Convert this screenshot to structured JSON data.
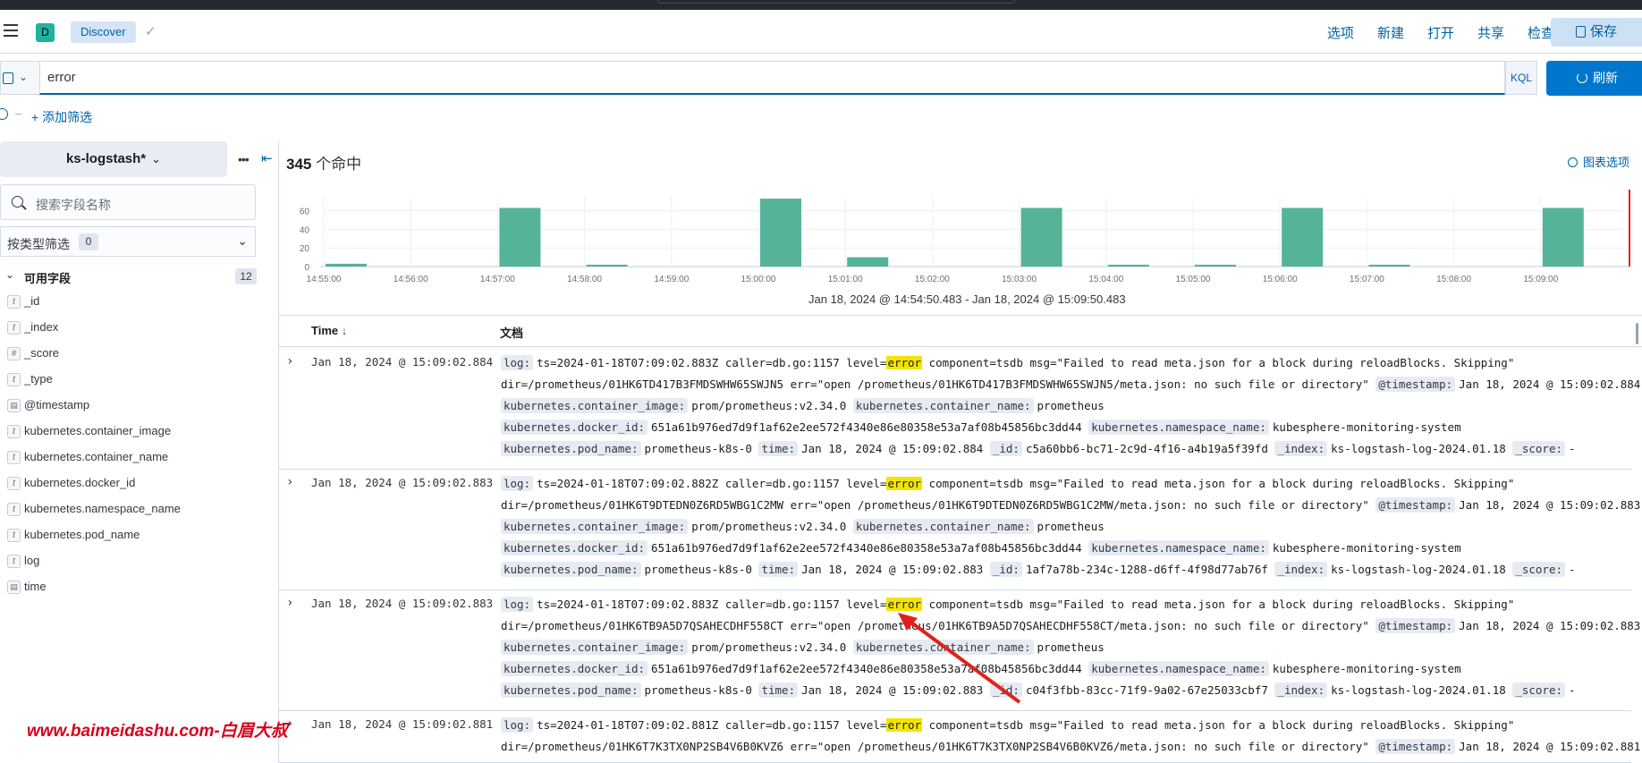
{
  "header": {
    "space_initial": "D",
    "breadcrumb": "Discover",
    "menu": [
      "选项",
      "新建",
      "打开",
      "共享",
      "检查"
    ],
    "save_label": "保存"
  },
  "query": {
    "value": "error",
    "language": "KQL",
    "refresh_label": "刷新"
  },
  "filters": {
    "add_label": "+ 添加筛选"
  },
  "sidebar": {
    "index_pattern": "ks-logstash*",
    "search_placeholder": "搜索字段名称",
    "type_filter_label": "按类型筛选",
    "type_filter_count": "0",
    "available_label": "可用字段",
    "available_count": "12",
    "fields": [
      {
        "type": "t",
        "name": "_id"
      },
      {
        "type": "t",
        "name": "_index"
      },
      {
        "type": "#",
        "name": "_score"
      },
      {
        "type": "t",
        "name": "_type"
      },
      {
        "type": "date",
        "name": "@timestamp"
      },
      {
        "type": "t",
        "name": "kubernetes.container_image"
      },
      {
        "type": "t",
        "name": "kubernetes.container_name"
      },
      {
        "type": "t",
        "name": "kubernetes.docker_id"
      },
      {
        "type": "t",
        "name": "kubernetes.namespace_name"
      },
      {
        "type": "t",
        "name": "kubernetes.pod_name"
      },
      {
        "type": "t",
        "name": "log"
      },
      {
        "type": "date",
        "name": "time"
      }
    ]
  },
  "main": {
    "hits_count": "345",
    "hits_suffix": " 个命中",
    "chart_options_label": "图表选项",
    "time_range": "Jan 18, 2024 @ 14:54:50.483 - Jan 18, 2024 @ 15:09:50.483",
    "col_time": "Time",
    "col_doc": "文档"
  },
  "chart_data": {
    "type": "bar",
    "x_ticks": [
      "14:55:00",
      "14:56:00",
      "14:57:00",
      "14:58:00",
      "14:59:00",
      "15:00:00",
      "15:01:00",
      "15:02:00",
      "15:03:00",
      "15:04:00",
      "15:05:00",
      "15:06:00",
      "15:07:00",
      "15:08:00",
      "15:09:00"
    ],
    "y_ticks": [
      0,
      20,
      40,
      60
    ],
    "ylim": [
      0,
      75
    ],
    "bars": [
      {
        "t": "14:55:00",
        "value": 3
      },
      {
        "t": "14:57:00",
        "value": 63
      },
      {
        "t": "14:58:00",
        "value": 2
      },
      {
        "t": "15:00:00",
        "value": 73
      },
      {
        "t": "15:01:00",
        "value": 10
      },
      {
        "t": "15:03:00",
        "value": 63
      },
      {
        "t": "15:04:00",
        "value": 2
      },
      {
        "t": "15:05:00",
        "value": 2
      },
      {
        "t": "15:06:00",
        "value": 63
      },
      {
        "t": "15:07:00",
        "value": 2
      },
      {
        "t": "15:09:00",
        "value": 63
      }
    ],
    "bar_color": "#54b399"
  },
  "rows": [
    {
      "ts": "Jan 18, 2024 @ 15:09:02.884",
      "log_pre": "ts=2024-01-18T07:09:02.883Z caller=db.go:1157 level=",
      "log_hl": "error",
      "log_post": " component=tsdb msg=\"Failed to read meta.json for a block during reloadBlocks. Skipping\"",
      "log_cont": "dir=/prometheus/01HK6TD417B3FMDSWHW65SWJN5 err=\"open /prometheus/01HK6TD417B3FMDSWHW65SWJN5/meta.json: no such file or directory\"",
      "timestamp": "Jan 18, 2024 @ 15:09:02.884",
      "container_image": "prom/prometheus:v2.34.0",
      "container_name": "prometheus",
      "docker_id": "651a61b976ed7d9f1af62e2ee572f4340e86e80358e53a7af08b45856bc3dd44",
      "namespace_name": "kubesphere-monitoring-system",
      "pod_name": "prometheus-k8s-0",
      "time": "Jan 18, 2024 @ 15:09:02.884",
      "id": "c5a60bb6-bc71-2c9d-4f16-a4b19a5f39fd",
      "index": "ks-logstash-log-2024.01.18",
      "score": "-"
    },
    {
      "ts": "Jan 18, 2024 @ 15:09:02.883",
      "log_pre": "ts=2024-01-18T07:09:02.882Z caller=db.go:1157 level=",
      "log_hl": "error",
      "log_post": " component=tsdb msg=\"Failed to read meta.json for a block during reloadBlocks. Skipping\"",
      "log_cont": "dir=/prometheus/01HK6T9DTEDN0Z6RD5WBG1C2MW err=\"open /prometheus/01HK6T9DTEDN0Z6RD5WBG1C2MW/meta.json: no such file or directory\"",
      "timestamp": "Jan 18, 2024 @ 15:09:02.883",
      "container_image": "prom/prometheus:v2.34.0",
      "container_name": "prometheus",
      "docker_id": "651a61b976ed7d9f1af62e2ee572f4340e86e80358e53a7af08b45856bc3dd44",
      "namespace_name": "kubesphere-monitoring-system",
      "pod_name": "prometheus-k8s-0",
      "time": "Jan 18, 2024 @ 15:09:02.883",
      "id": "1af7a78b-234c-1288-d6ff-4f98d77ab76f",
      "index": "ks-logstash-log-2024.01.18",
      "score": "-"
    },
    {
      "ts": "Jan 18, 2024 @ 15:09:02.883",
      "log_pre": "ts=2024-01-18T07:09:02.883Z caller=db.go:1157 level=",
      "log_hl": "error",
      "log_post": " component=tsdb msg=\"Failed to read meta.json for a block during reloadBlocks. Skipping\"",
      "log_cont": "dir=/prometheus/01HK6TB9A5D7QSAHECDHF558CT err=\"open /prometheus/01HK6TB9A5D7QSAHECDHF558CT/meta.json: no such file or directory\"",
      "timestamp": "Jan 18, 2024 @ 15:09:02.883",
      "container_image": "prom/prometheus:v2.34.0",
      "container_name": "prometheus",
      "docker_id": "651a61b976ed7d9f1af62e2ee572f4340e86e80358e53a7af08b45856bc3dd44",
      "namespace_name": "kubesphere-monitoring-system",
      "pod_name": "prometheus-k8s-0",
      "time": "Jan 18, 2024 @ 15:09:02.883",
      "id": "c04f3fbb-83cc-71f9-9a02-67e25033cbf7",
      "index": "ks-logstash-log-2024.01.18",
      "score": "-"
    },
    {
      "ts": "Jan 18, 2024 @ 15:09:02.881",
      "log_pre": "ts=2024-01-18T07:09:02.881Z caller=db.go:1157 level=",
      "log_hl": "error",
      "log_post": " component=tsdb msg=\"Failed to read meta.json for a block during reloadBlocks. Skipping\"",
      "log_cont": "dir=/prometheus/01HK6T7K3TX0NP2SB4V6B0KVZ6 err=\"open /prometheus/01HK6T7K3TX0NP2SB4V6B0KVZ6/meta.json: no such file or directory\"",
      "timestamp": "Jan 18, 2024 @ 15:09:02.881"
    }
  ],
  "labels": {
    "log": "log:",
    "timestamp": "@timestamp:",
    "container_image": "kubernetes.container_image:",
    "container_name": "kubernetes.container_name:",
    "docker_id": "kubernetes.docker_id:",
    "namespace_name": "kubernetes.namespace_name:",
    "pod_name": "kubernetes.pod_name:",
    "time": "time:",
    "id": "_id:",
    "index": "_index:",
    "score": "_score:"
  },
  "watermark": "www.baimeidashu.com-白眉大叔"
}
